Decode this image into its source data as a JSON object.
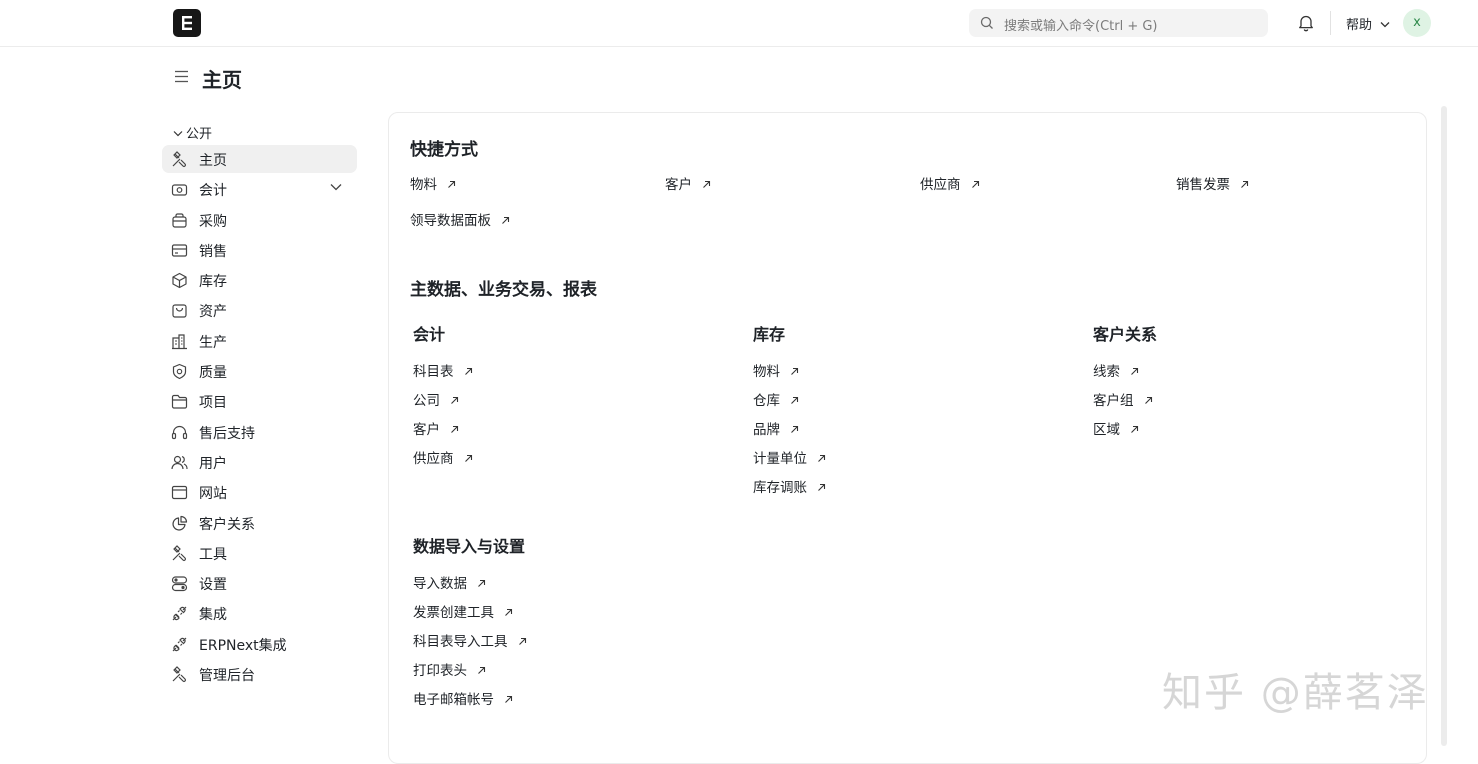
{
  "header": {
    "logo_letter": "E",
    "search_placeholder": "搜索或输入命令(Ctrl + G)",
    "help_label": "帮助",
    "avatar_initial": "x"
  },
  "page": {
    "title": "主页"
  },
  "sidebar": {
    "section_label": "公开",
    "items": [
      {
        "label": "主页",
        "icon": "tools-icon"
      },
      {
        "label": "会计",
        "icon": "money-icon"
      },
      {
        "label": "采购",
        "icon": "basket-icon"
      },
      {
        "label": "销售",
        "icon": "card-icon"
      },
      {
        "label": "库存",
        "icon": "box-icon"
      },
      {
        "label": "资产",
        "icon": "bag-icon"
      },
      {
        "label": "生产",
        "icon": "factory-icon"
      },
      {
        "label": "质量",
        "icon": "shield-icon"
      },
      {
        "label": "项目",
        "icon": "folder-icon"
      },
      {
        "label": "售后支持",
        "icon": "headset-icon"
      },
      {
        "label": "用户",
        "icon": "users-icon"
      },
      {
        "label": "网站",
        "icon": "browser-icon"
      },
      {
        "label": "客户关系",
        "icon": "pie-chart-icon"
      },
      {
        "label": "工具",
        "icon": "tools-icon"
      },
      {
        "label": "设置",
        "icon": "toggle-icon"
      },
      {
        "label": "集成",
        "icon": "plug-icon"
      },
      {
        "label": "ERPNext集成",
        "icon": "plug-icon"
      },
      {
        "label": "管理后台",
        "icon": "tools-icon"
      }
    ]
  },
  "shortcuts": {
    "title": "快捷方式",
    "links": [
      "物料",
      "客户",
      "供应商",
      "销售发票",
      "领导数据面板"
    ]
  },
  "masters": {
    "title": "主数据、业务交易、报表",
    "columns": [
      {
        "title": "会计",
        "links": [
          "科目表",
          "公司",
          "客户",
          "供应商"
        ]
      },
      {
        "title": "库存",
        "links": [
          "物料",
          "仓库",
          "品牌",
          "计量单位",
          "库存调账"
        ]
      },
      {
        "title": "客户关系",
        "links": [
          "线索",
          "客户组",
          "区域"
        ]
      }
    ],
    "import_section": {
      "title": "数据导入与设置",
      "links": [
        "导入数据",
        "发票创建工具",
        "科目表导入工具",
        "打印表头",
        "电子邮箱帐号"
      ]
    }
  },
  "watermark": "知乎 @薛茗泽"
}
